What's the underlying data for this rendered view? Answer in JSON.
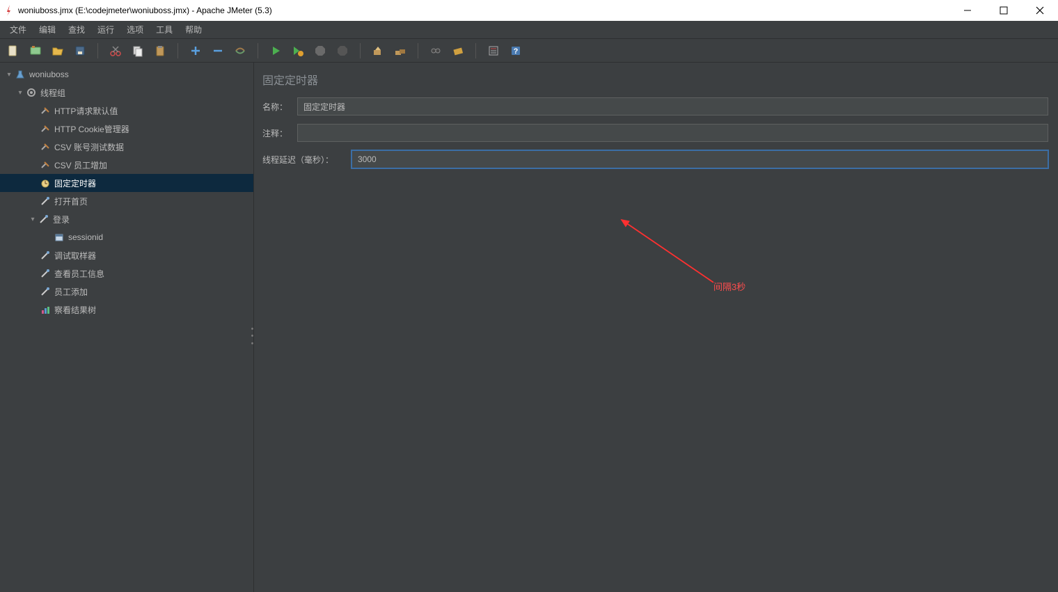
{
  "window": {
    "title": "woniuboss.jmx (E:\\codejmeter\\woniuboss.jmx) - Apache JMeter (5.3)"
  },
  "menubar": {
    "items": [
      "文件",
      "编辑",
      "查找",
      "运行",
      "选项",
      "工具",
      "帮助"
    ]
  },
  "toolbar": {
    "buttons": [
      "new-file",
      "templates",
      "open",
      "save",
      "cut",
      "copy",
      "paste",
      "add",
      "remove",
      "toggle",
      "start",
      "start-no-timers",
      "stop",
      "shutdown",
      "clear",
      "clear-all",
      "search",
      "function-helper",
      "test-plan",
      "help"
    ]
  },
  "tree": {
    "root": {
      "label": "woniuboss"
    },
    "threadGroup": {
      "label": "线程组"
    },
    "items": [
      {
        "label": "HTTP请求默认值",
        "icon": "config"
      },
      {
        "label": "HTTP Cookie管理器",
        "icon": "config"
      },
      {
        "label": "CSV 账号测试数据",
        "icon": "config"
      },
      {
        "label": "CSV 员工增加",
        "icon": "config"
      },
      {
        "label": "固定定时器",
        "icon": "timer",
        "selected": true
      },
      {
        "label": "打开首页",
        "icon": "sampler"
      },
      {
        "label": "登录",
        "icon": "sampler",
        "expandable": true
      },
      {
        "label": "sessionid",
        "icon": "extractor",
        "child": true
      },
      {
        "label": "调试取样器",
        "icon": "sampler"
      },
      {
        "label": "查看员工信息",
        "icon": "sampler"
      },
      {
        "label": "员工添加",
        "icon": "sampler"
      },
      {
        "label": "察看结果树",
        "icon": "listener"
      }
    ]
  },
  "panel": {
    "title": "固定定时器",
    "nameLabel": "名称：",
    "nameValue": "固定定时器",
    "commentLabel": "注释：",
    "commentValue": "",
    "delayLabel": "线程延迟（毫秒）：",
    "delayValue": "3000"
  },
  "annotation": {
    "text": "间隔3秒"
  }
}
